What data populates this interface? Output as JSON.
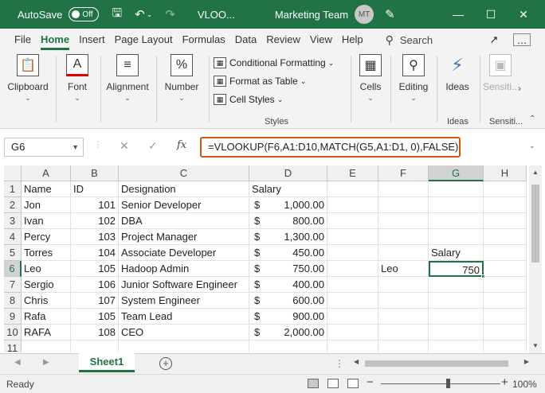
{
  "titlebar": {
    "autosave_label": "AutoSave",
    "autosave_state": "Off",
    "filename": "VLOO...",
    "team": "Marketing Team",
    "avatar_initials": "MT"
  },
  "tabs": [
    "File",
    "Home",
    "Insert",
    "Page Layout",
    "Formulas",
    "Data",
    "Review",
    "View",
    "Help"
  ],
  "active_tab": "Home",
  "search_label": "Search",
  "ribbon": {
    "clipboard": "Clipboard",
    "font": "Font",
    "alignment": "Alignment",
    "number": "Number",
    "styles_items": [
      "Conditional Formatting",
      "Format as Table",
      "Cell Styles"
    ],
    "styles_group": "Styles",
    "cells": "Cells",
    "editing": "Editing",
    "ideas": "Ideas",
    "ideas_group": "Ideas",
    "sensitivity": "Sensiti...",
    "sensitivity_group": "Sensiti..."
  },
  "formula_bar": {
    "name_box": "G6",
    "fx": "fx",
    "formula": "=VLOOKUP(F6,A1:D10,MATCH(G5,A1:D1, 0),FALSE)"
  },
  "columns": [
    "A",
    "B",
    "C",
    "D",
    "E",
    "F",
    "G",
    "H"
  ],
  "selected_column": "G",
  "selected_row": "6",
  "rows": [
    {
      "num": "1",
      "A": "Name",
      "B": "ID",
      "C": "Designation",
      "D": "Salary",
      "D_dollar": "",
      "F": "",
      "G": ""
    },
    {
      "num": "2",
      "A": "Jon",
      "B": "101",
      "C": "Senior Developer",
      "D": "1,000.00",
      "D_dollar": "$",
      "F": "",
      "G": ""
    },
    {
      "num": "3",
      "A": "Ivan",
      "B": "102",
      "C": "DBA",
      "D": "800.00",
      "D_dollar": "$",
      "F": "",
      "G": ""
    },
    {
      "num": "4",
      "A": "Percy",
      "B": "103",
      "C": "Project Manager",
      "D": "1,300.00",
      "D_dollar": "$",
      "F": "",
      "G": ""
    },
    {
      "num": "5",
      "A": "Torres",
      "B": "104",
      "C": "Associate Developer",
      "D": "450.00",
      "D_dollar": "$",
      "F": "",
      "G": "Salary"
    },
    {
      "num": "6",
      "A": "Leo",
      "B": "105",
      "C": "Hadoop Admin",
      "D": "750.00",
      "D_dollar": "$",
      "F": "Leo",
      "G": "750"
    },
    {
      "num": "7",
      "A": "Sergio",
      "B": "106",
      "C": "Junior Software Engineer",
      "D": "400.00",
      "D_dollar": "$",
      "F": "",
      "G": ""
    },
    {
      "num": "8",
      "A": "Chris",
      "B": "107",
      "C": "System Engineer",
      "D": "600.00",
      "D_dollar": "$",
      "F": "",
      "G": ""
    },
    {
      "num": "9",
      "A": "Rafa",
      "B": "105",
      "C": "Team Lead",
      "D": "900.00",
      "D_dollar": "$",
      "F": "",
      "G": ""
    },
    {
      "num": "10",
      "A": "RAFA",
      "B": "108",
      "C": "CEO",
      "D": "2,000.00",
      "D_dollar": "$",
      "F": "",
      "G": ""
    },
    {
      "num": "11",
      "A": "",
      "B": "",
      "C": "",
      "D": "",
      "D_dollar": "",
      "F": "",
      "G": ""
    }
  ],
  "sheet_tab": "Sheet1",
  "status": "Ready",
  "zoom": "100%",
  "colors": {
    "excel_green": "#217346",
    "formula_highlight": "#c55a11"
  }
}
